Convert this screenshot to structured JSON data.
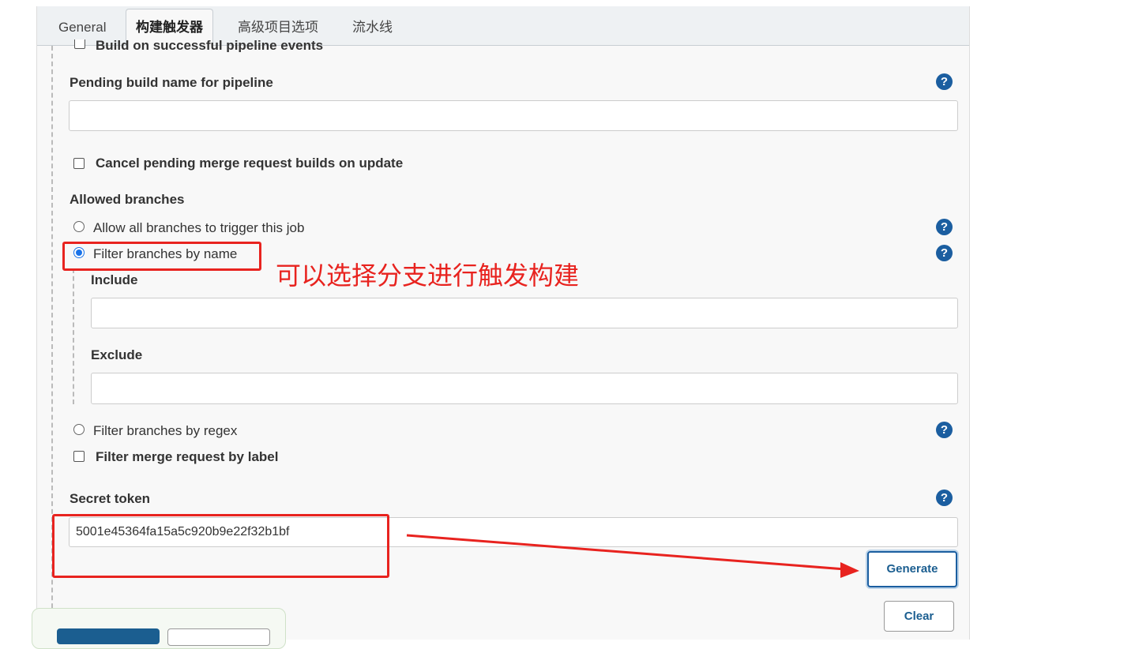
{
  "tabs": [
    {
      "label": "General"
    },
    {
      "label": "构建触发器"
    },
    {
      "label": "高级项目选项"
    },
    {
      "label": "流水线"
    }
  ],
  "build_on_success": {
    "label": "Build on successful pipeline events"
  },
  "pending_build": {
    "label": "Pending build name for pipeline",
    "value": ""
  },
  "cancel_pending": {
    "label": "Cancel pending merge request builds on update"
  },
  "allowed_branches": {
    "label": "Allowed branches",
    "allow_all": "Allow all branches to trigger this job",
    "filter_by_name": "Filter branches by name",
    "include_label": "Include",
    "include_value": "",
    "exclude_label": "Exclude",
    "exclude_value": "",
    "filter_by_regex": "Filter branches by regex",
    "filter_mr_label": "Filter merge request by label"
  },
  "secret_token": {
    "label": "Secret token",
    "value": "5001e45364fa15a5c920b9e22f32b1bf"
  },
  "buttons": {
    "generate": "Generate",
    "clear": "Clear"
  },
  "help_glyph": "?",
  "annotation": {
    "text": "可以选择分支进行触发构建",
    "color": "#e8231f"
  },
  "colors": {
    "help": "#1b5ea0",
    "radio_checked": "#1a73e8",
    "annotation": "#e8231f"
  }
}
